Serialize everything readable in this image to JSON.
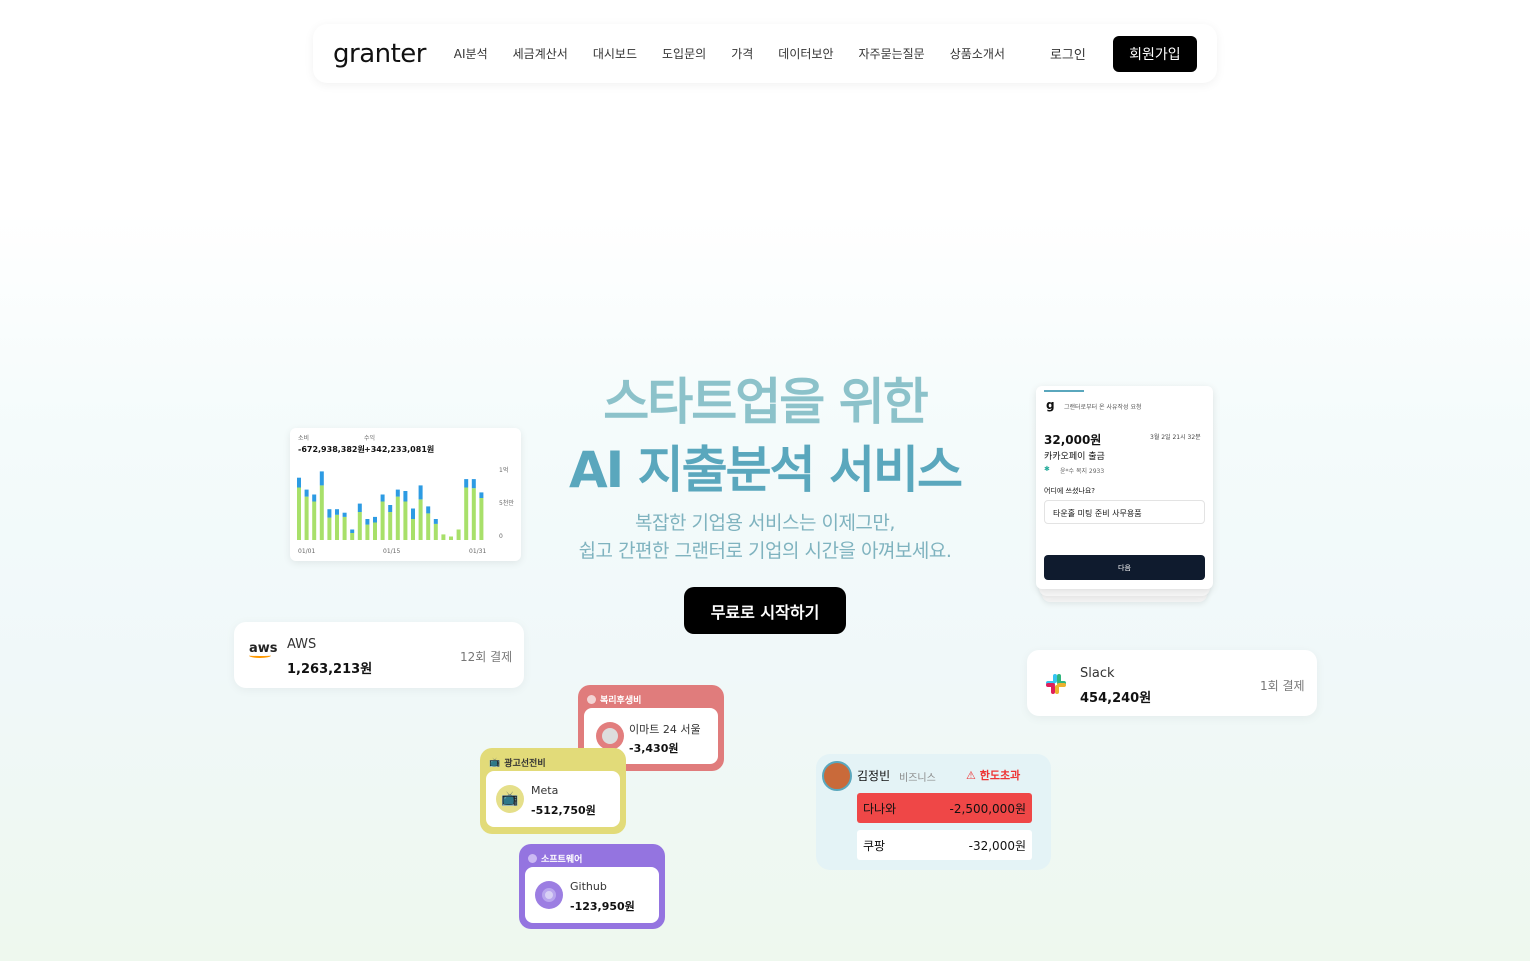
{
  "nav": {
    "logo": "granter",
    "menu": [
      "AI분석",
      "세금계산서",
      "대시보드",
      "도입문의",
      "가격",
      "데이터보안",
      "자주묻는질문",
      "상품소개서"
    ],
    "login": "로그인",
    "signup": "회원가입"
  },
  "hero": {
    "line1": "스타트업을 위한",
    "line2": "AI 지출분석 서비스",
    "sub1": "복잡한 기업용 서비스는 이제그만,",
    "sub2": "쉽고 간편한 그랜터로 기업의 시간을 아껴보세요.",
    "cta": "무료로 시작하기"
  },
  "chart_card": {
    "expense_label": "소비",
    "expense_value": "-672,938,382원",
    "income_label": "수익",
    "income_value": "+342,233,081원",
    "y_ticks": [
      "1억",
      "5천만",
      "0"
    ],
    "x_ticks": [
      "01/01",
      "01/15",
      "01/31"
    ]
  },
  "chart_data": {
    "type": "bar",
    "series": [
      {
        "name": "green",
        "values": [
          0.75,
          0.62,
          0.55,
          0.78,
          0.32,
          0.36,
          0.33,
          0.1,
          0.4,
          0.22,
          0.25,
          0.55,
          0.4,
          0.62,
          0.55,
          0.3,
          0.58,
          0.38,
          0.23,
          0.08,
          0.05,
          0.15,
          0.75,
          0.74,
          0.6
        ]
      },
      {
        "name": "blue",
        "values": [
          0.14,
          0.1,
          0.1,
          0.2,
          0.12,
          0.08,
          0.06,
          0.05,
          0.12,
          0.08,
          0.08,
          0.1,
          0.1,
          0.1,
          0.15,
          0.15,
          0.2,
          0.1,
          0.07,
          0.0,
          0.0,
          0.0,
          0.12,
          0.13,
          0.08
        ]
      }
    ],
    "colors": {
      "green": "#a8e06a",
      "blue": "#2d9be3"
    },
    "x": [
      "01/01",
      "01/15",
      "01/31"
    ],
    "yticks": [
      "1억",
      "5천만",
      "0"
    ]
  },
  "aws_card": {
    "name": "AWS",
    "amount": "1,263,213원",
    "count": "12회 결제",
    "logo": "aws"
  },
  "slack_card": {
    "name": "Slack",
    "amount": "454,240원",
    "count": "1회 결제"
  },
  "kakao_card": {
    "header": "그랜터로부터 온 사유작성 요청",
    "amount": "32,000원",
    "date": "3월 2일 21시 32분",
    "merchant": "카카오페이 출금",
    "user": "윤*수 복지 2933",
    "question": "어디에 쓰셨나요?",
    "answer": "타운홀 미팅 준비 사무용품",
    "next": "다음"
  },
  "categories": {
    "welfare": {
      "title": "복리후생비",
      "name": "이마트 24 서울",
      "amount": "-3,430원",
      "color": "#e07c7c"
    },
    "ads": {
      "title": "광고선전비",
      "name": "Meta",
      "amount": "-512,750원",
      "color": "#e2db79"
    },
    "software": {
      "title": "소프트웨어",
      "name": "Github",
      "amount": "-123,950원",
      "color": "#9474e0"
    }
  },
  "limit_card": {
    "name": "김정빈",
    "dept": "비즈니스",
    "alert": "한도초과",
    "rows": [
      {
        "merchant": "다나와",
        "amount": "-2,500,000원"
      },
      {
        "merchant": "쿠팡",
        "amount": "-32,000원"
      }
    ]
  }
}
